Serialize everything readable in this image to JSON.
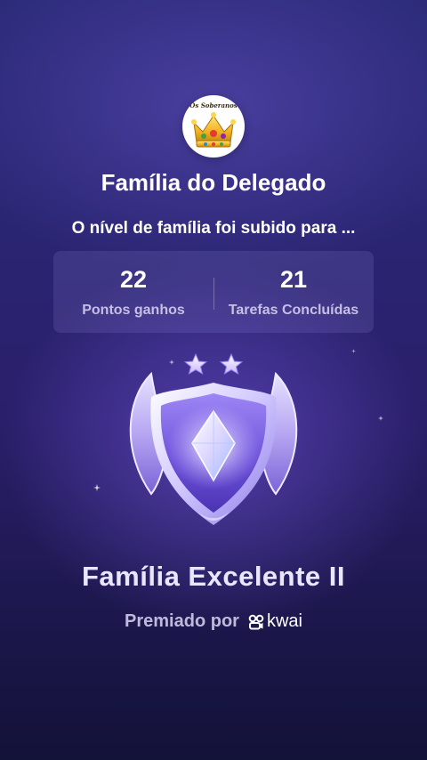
{
  "family": {
    "avatar_text": "Os Soberanos",
    "name": "Família do Delegado"
  },
  "level_message": "O nível de família foi subido para ...",
  "stats": [
    {
      "value": "22",
      "label": "Pontos ganhos"
    },
    {
      "value": "21",
      "label": "Tarefas Concluídas"
    }
  ],
  "badge": {
    "stars": 2,
    "name": "Família Excelente II"
  },
  "awarded": {
    "label": "Premiado por",
    "brand": "kwai"
  },
  "icons": {
    "avatar": "crown-icon",
    "badge": "shield-badge-icon",
    "star": "star-icon",
    "brand": "kwai-logo-icon"
  },
  "colors": {
    "background_top": "#2b2a78",
    "background_bottom": "#131238",
    "badge_violet": "#8f7cf0",
    "text_muted": "#dcd7f5"
  }
}
